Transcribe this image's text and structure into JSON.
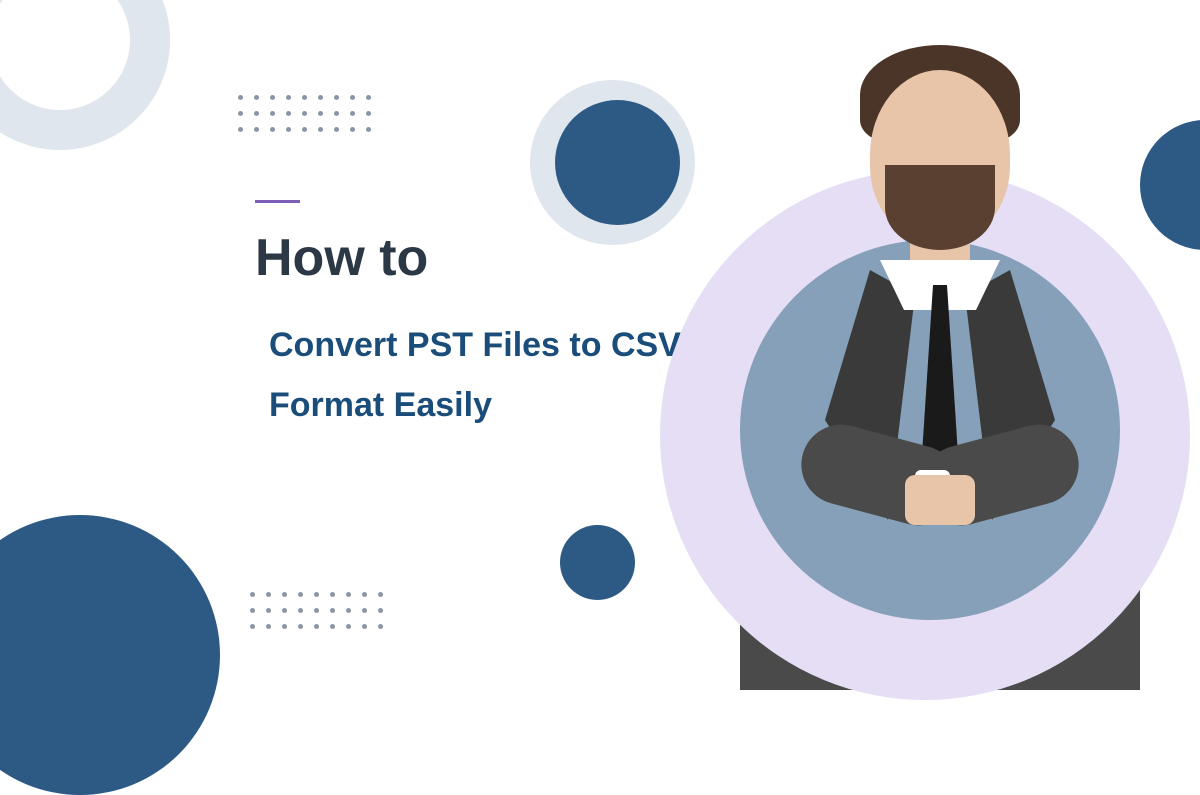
{
  "heading": {
    "line1": "How to",
    "line2": "Convert PST Files to CSV",
    "line3": "Format Easily"
  },
  "colors": {
    "primary_blue": "#2d5a85",
    "light_gray": "#dfe6ed",
    "lavender": "#e5def5",
    "blue_gray": "#85a0b8",
    "accent_purple": "#7b5fb8",
    "text_dark": "#2c3845",
    "text_blue": "#1a4d7a"
  }
}
